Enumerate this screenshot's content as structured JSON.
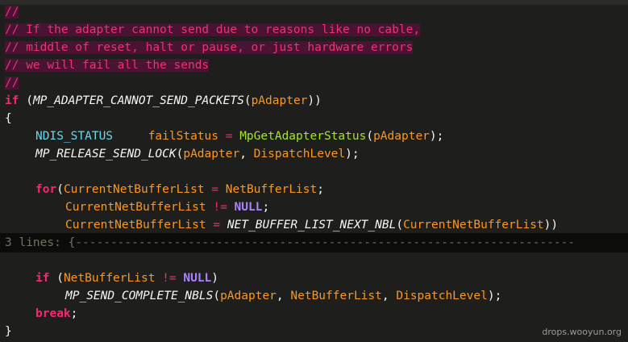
{
  "comment_lines": [
    "//",
    "// If the adapter cannot send due to reasons like no cable,",
    "// middle of reset, halt or pause, or just hardware errors",
    "// we will fail all the sends",
    "//"
  ],
  "code": {
    "if1_kw": "if",
    "if1_rest_a": " (",
    "if1_macro": "MP_ADAPTER_CANNOT_SEND_PACKETS",
    "if1_paren_open": "(",
    "if1_arg": "pAdapter",
    "if1_paren_close": "))",
    "brace_open": "{",
    "status_type": "NDIS_STATUS",
    "status_var": "failStatus",
    "status_eq": " = ",
    "status_fn": "MpGetAdapterStatus",
    "status_open": "(",
    "status_arg": "pAdapter",
    "status_close": ");",
    "release_macro": "MP_RELEASE_SEND_LOCK",
    "release_open": "(",
    "release_arg1": "pAdapter",
    "release_comma": ", ",
    "release_arg2": "DispatchLevel",
    "release_close": ");",
    "for_kw": "for",
    "for_open": "(",
    "for_var1": "CurrentNetBufferList",
    "for_eq": " = ",
    "for_var2": "NetBufferList",
    "for_semi1": ";",
    "for2_var": "CurrentNetBufferList",
    "for2_op": " != ",
    "for2_null": "NULL",
    "for2_semi": ";",
    "for3_var": "CurrentNetBufferList",
    "for3_eq": " = ",
    "for3_macro": "NET_BUFFER_LIST_NEXT_NBL",
    "for3_open": "(",
    "for3_arg": "CurrentNetBufferList",
    "for3_close": "))",
    "fold_label": "3 lines: {-----------------------------------------------------------------------",
    "if2_kw": "if",
    "if2_open": " (",
    "if2_var": "NetBufferList",
    "if2_op": " != ",
    "if2_null": "NULL",
    "if2_close": ")",
    "complete_macro": "MP_SEND_COMPLETE_NBLS",
    "complete_open": "(",
    "complete_arg1": "pAdapter",
    "complete_c1": ", ",
    "complete_arg2": "NetBufferList",
    "complete_c2": ", ",
    "complete_arg3": "DispatchLevel",
    "complete_close": ");",
    "break_kw": "break",
    "break_semi": ";",
    "brace_close": "}"
  },
  "watermark": "drops.wooyun.org",
  "colors": {
    "background": "#1e1f1c",
    "comment_highlight": "#4a1233",
    "comment_text": "#e8356f",
    "keyword": "#f92672",
    "function_green": "#a6e22e",
    "type_cyan": "#66d9ef",
    "variable_orange": "#fd971f",
    "null_purple": "#ae81ff",
    "fold_bar": "#0c0c0b"
  }
}
